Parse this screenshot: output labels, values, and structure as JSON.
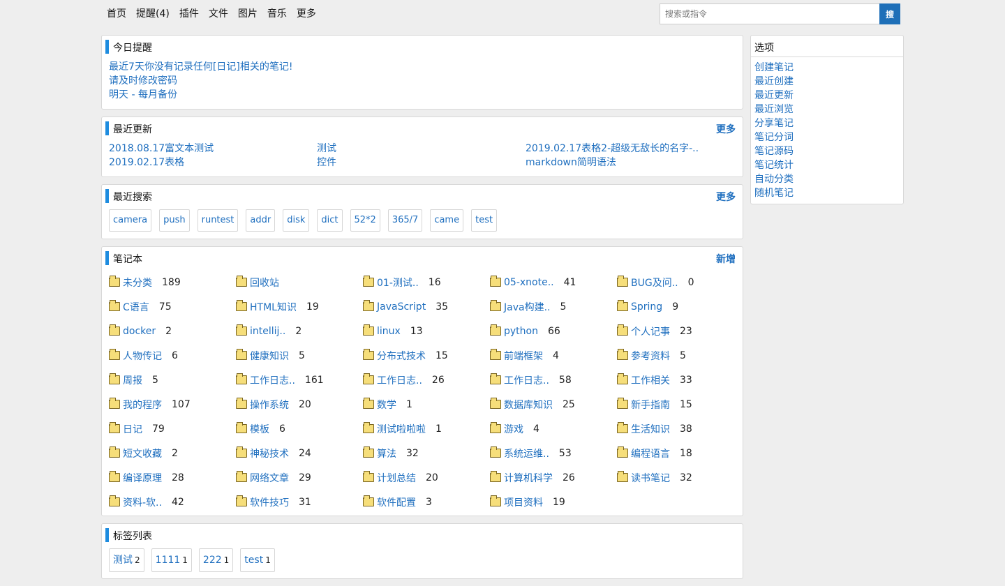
{
  "nav": {
    "links": [
      "首页",
      "提醒(4)",
      "插件",
      "文件",
      "图片",
      "音乐",
      "更多"
    ],
    "search_placeholder": "搜索或指令",
    "search_button": "搜"
  },
  "reminders": {
    "title": "今日提醒",
    "items": [
      "最近7天你没有记录任何[日记]相关的笔记!",
      "请及时修改密码",
      "明天 - 每月备份"
    ]
  },
  "recent_updates": {
    "title": "最近更新",
    "more": "更多",
    "items": [
      "2018.08.17富文本测试",
      "测试",
      "2019.02.17表格2-超级无敌长的名字-..",
      "2019.02.17表格",
      "控件",
      "markdown简明语法"
    ]
  },
  "recent_search": {
    "title": "最近搜索",
    "more": "更多",
    "items": [
      "camera",
      "push",
      "runtest",
      "addr",
      "disk",
      "dict",
      "52*2",
      "365/7",
      "came",
      "test"
    ]
  },
  "notebooks": {
    "title": "笔记本",
    "add": "新增",
    "items": [
      {
        "name": "未分类",
        "count": "189"
      },
      {
        "name": "回收站",
        "count": ""
      },
      {
        "name": "01-测试..",
        "count": "16"
      },
      {
        "name": "05-xnote..",
        "count": "41"
      },
      {
        "name": "BUG及问..",
        "count": "0"
      },
      {
        "name": "C语言",
        "count": "75"
      },
      {
        "name": "HTML知识",
        "count": "19"
      },
      {
        "name": "JavaScript",
        "count": "35"
      },
      {
        "name": "Java构建..",
        "count": "5"
      },
      {
        "name": "Spring",
        "count": "9"
      },
      {
        "name": "docker",
        "count": "2"
      },
      {
        "name": "intellij..",
        "count": "2"
      },
      {
        "name": "linux",
        "count": "13"
      },
      {
        "name": "python",
        "count": "66"
      },
      {
        "name": "个人记事",
        "count": "23"
      },
      {
        "name": "人物传记",
        "count": "6"
      },
      {
        "name": "健康知识",
        "count": "5"
      },
      {
        "name": "分布式技术",
        "count": "15"
      },
      {
        "name": "前端框架",
        "count": "4"
      },
      {
        "name": "参考资料",
        "count": "5"
      },
      {
        "name": "周报",
        "count": "5"
      },
      {
        "name": "工作日志..",
        "count": "161"
      },
      {
        "name": "工作日志..",
        "count": "26"
      },
      {
        "name": "工作日志..",
        "count": "58"
      },
      {
        "name": "工作相关",
        "count": "33"
      },
      {
        "name": "我的程序",
        "count": "107"
      },
      {
        "name": "操作系统",
        "count": "20"
      },
      {
        "name": "数学",
        "count": "1"
      },
      {
        "name": "数据库知识",
        "count": "25"
      },
      {
        "name": "新手指南",
        "count": "15"
      },
      {
        "name": "日记",
        "count": "79"
      },
      {
        "name": "模板",
        "count": "6"
      },
      {
        "name": "测试啦啦啦",
        "count": "1"
      },
      {
        "name": "游戏",
        "count": "4"
      },
      {
        "name": "生活知识",
        "count": "38"
      },
      {
        "name": "短文收藏",
        "count": "2"
      },
      {
        "name": "神秘技术",
        "count": "24"
      },
      {
        "name": "算法",
        "count": "32"
      },
      {
        "name": "系统运维..",
        "count": "53"
      },
      {
        "name": "编程语言",
        "count": "18"
      },
      {
        "name": "编译原理",
        "count": "28"
      },
      {
        "name": "网络文章",
        "count": "29"
      },
      {
        "name": "计划总结",
        "count": "20"
      },
      {
        "name": "计算机科学",
        "count": "26"
      },
      {
        "name": "读书笔记",
        "count": "32"
      },
      {
        "name": "资料-软..",
        "count": "42"
      },
      {
        "name": "软件技巧",
        "count": "31"
      },
      {
        "name": "软件配置",
        "count": "3"
      },
      {
        "name": "项目资料",
        "count": "19"
      }
    ]
  },
  "tag_list": {
    "title": "标签列表",
    "items": [
      {
        "name": "测试",
        "count": "2"
      },
      {
        "name": "1111",
        "count": "1"
      },
      {
        "name": "222",
        "count": "1"
      },
      {
        "name": "test",
        "count": "1"
      }
    ]
  },
  "sidebar": {
    "title": "选项",
    "items": [
      "创建笔记",
      "最近创建",
      "最近更新",
      "最近浏览",
      "分享笔记",
      "笔记分词",
      "笔记源码",
      "笔记统计",
      "自动分类",
      "随机笔记"
    ]
  }
}
